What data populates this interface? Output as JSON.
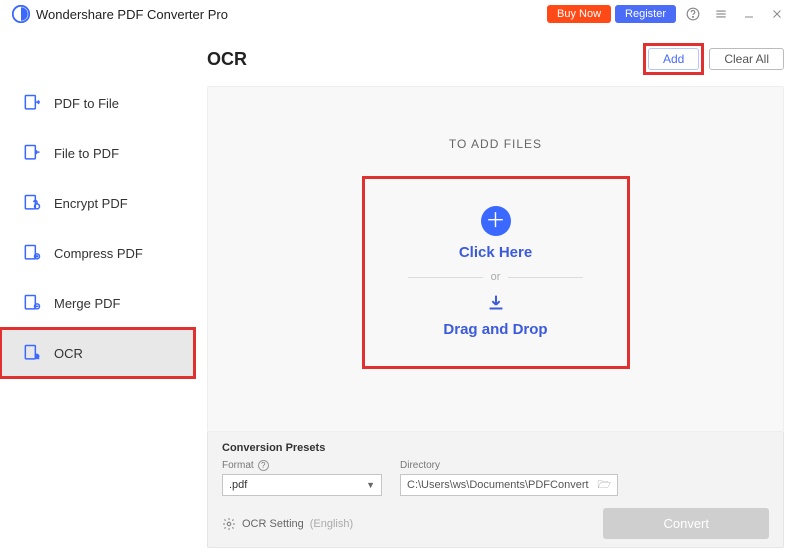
{
  "app": {
    "title": "Wondershare PDF Converter Pro"
  },
  "header": {
    "buy": "Buy Now",
    "register": "Register"
  },
  "sidebar": {
    "items": [
      {
        "label": "PDF to File"
      },
      {
        "label": "File to PDF"
      },
      {
        "label": "Encrypt PDF"
      },
      {
        "label": "Compress PDF"
      },
      {
        "label": "Merge PDF"
      },
      {
        "label": "OCR"
      }
    ]
  },
  "page": {
    "title": "OCR",
    "add": "Add",
    "clear": "Clear All"
  },
  "dropzone": {
    "toadd": "TO ADD FILES",
    "click": "Click Here",
    "or": "or",
    "drag": "Drag and Drop"
  },
  "presets": {
    "title": "Conversion Presets",
    "format_label": "Format",
    "format_value": ".pdf",
    "directory_label": "Directory",
    "directory_value": "C:\\Users\\ws\\Documents\\PDFConvert"
  },
  "settings": {
    "label": "OCR Setting",
    "lang": "(English)"
  },
  "convert": "Convert"
}
